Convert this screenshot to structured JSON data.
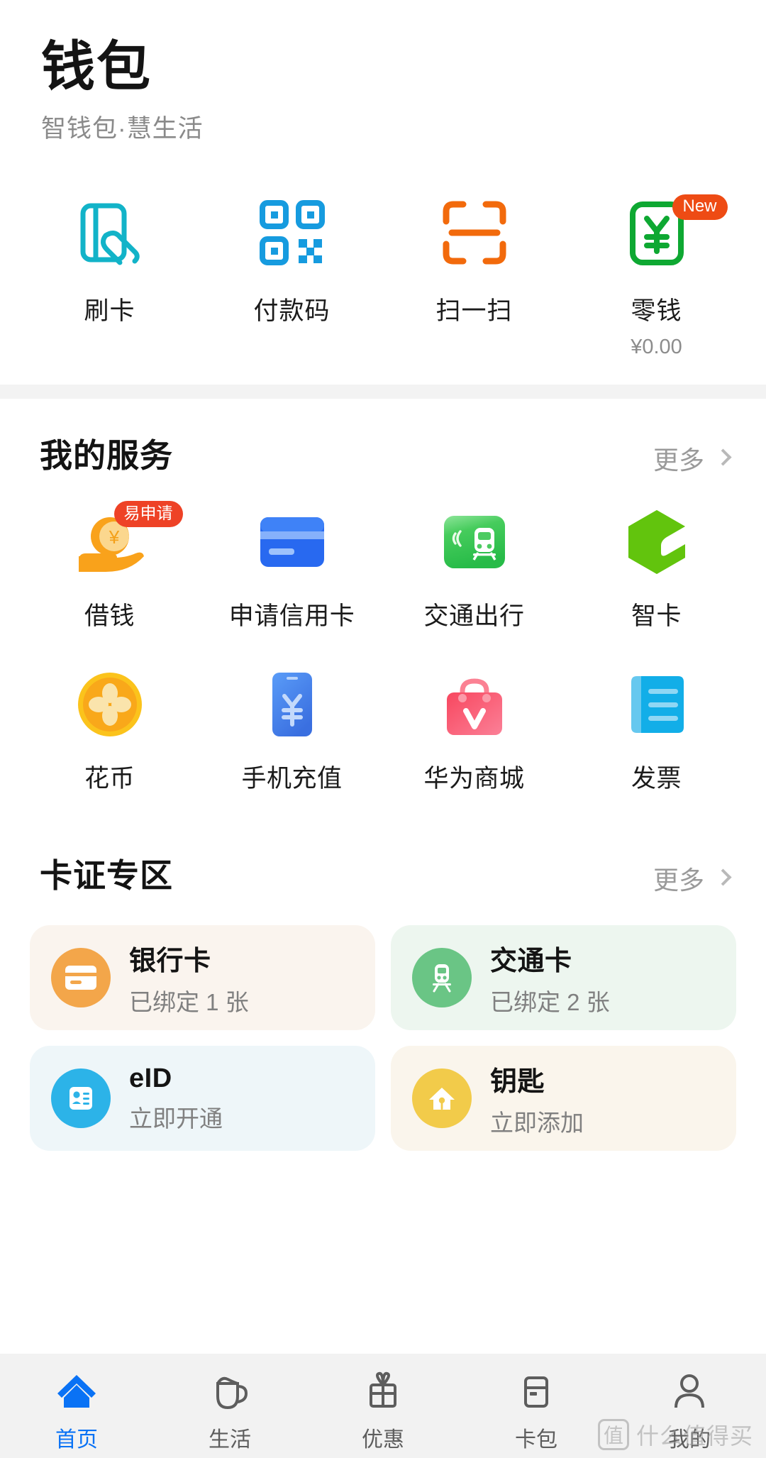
{
  "header": {
    "title": "钱包",
    "subtitle": "智钱包·慧生活"
  },
  "quick_actions": {
    "items": [
      {
        "label": "刷卡",
        "icon": "card-swipe-icon",
        "color": "#12b3c8",
        "sub": "",
        "badge": ""
      },
      {
        "label": "付款码",
        "icon": "qr-code-icon",
        "color": "#169bdf",
        "sub": "",
        "badge": ""
      },
      {
        "label": "扫一扫",
        "icon": "scan-frame-icon",
        "color": "#f26a0c",
        "sub": "",
        "badge": ""
      },
      {
        "label": "零钱",
        "icon": "yuan-wallet-icon",
        "color": "#0ea832",
        "sub": "¥0.00",
        "badge": "New"
      }
    ]
  },
  "my_services": {
    "title": "我的服务",
    "more": "更多",
    "items": [
      {
        "label": "借钱",
        "icon": "hand-coin-icon",
        "badge": "易申请"
      },
      {
        "label": "申请信用卡",
        "icon": "credit-card-icon",
        "badge": ""
      },
      {
        "label": "交通出行",
        "icon": "transit-card-icon",
        "badge": ""
      },
      {
        "label": "智卡",
        "icon": "smart-card-hexagon-icon",
        "badge": ""
      },
      {
        "label": "花币",
        "icon": "petal-coin-icon",
        "badge": ""
      },
      {
        "label": "手机充值",
        "icon": "phone-topup-icon",
        "badge": ""
      },
      {
        "label": "华为商城",
        "icon": "shopping-bag-icon",
        "badge": ""
      },
      {
        "label": "发票",
        "icon": "invoice-icon",
        "badge": ""
      }
    ]
  },
  "cards_zone": {
    "title": "卡证专区",
    "more": "更多",
    "tiles": [
      {
        "title": "银行卡",
        "sub": "已绑定 1 张",
        "icon": "bank-card-icon",
        "tile_bg": "#faf4ee",
        "icon_bg": "#f3a64a"
      },
      {
        "title": "交通卡",
        "sub": "已绑定 2 张",
        "icon": "transit-train-icon",
        "tile_bg": "#edf6ef",
        "icon_bg": "#6ac585"
      },
      {
        "title": "eID",
        "sub": "立即开通",
        "icon": "id-card-icon",
        "tile_bg": "#eef6f9",
        "icon_bg": "#2cb3e8"
      },
      {
        "title": "钥匙",
        "sub": "立即添加",
        "icon": "house-key-icon",
        "tile_bg": "#faf5ec",
        "icon_bg": "#f2cb4a"
      }
    ]
  },
  "tabbar": {
    "items": [
      {
        "label": "首页",
        "icon": "home-icon",
        "active": true
      },
      {
        "label": "生活",
        "icon": "cup-icon",
        "active": false
      },
      {
        "label": "优惠",
        "icon": "gift-icon",
        "active": false
      },
      {
        "label": "卡包",
        "icon": "wallet-card-icon",
        "active": false
      },
      {
        "label": "我的",
        "icon": "person-icon",
        "active": false
      }
    ],
    "active_color": "#0a72f5",
    "inactive_color": "#5d5d5d"
  },
  "watermark": {
    "badge": "值",
    "text": "什么值得买"
  }
}
